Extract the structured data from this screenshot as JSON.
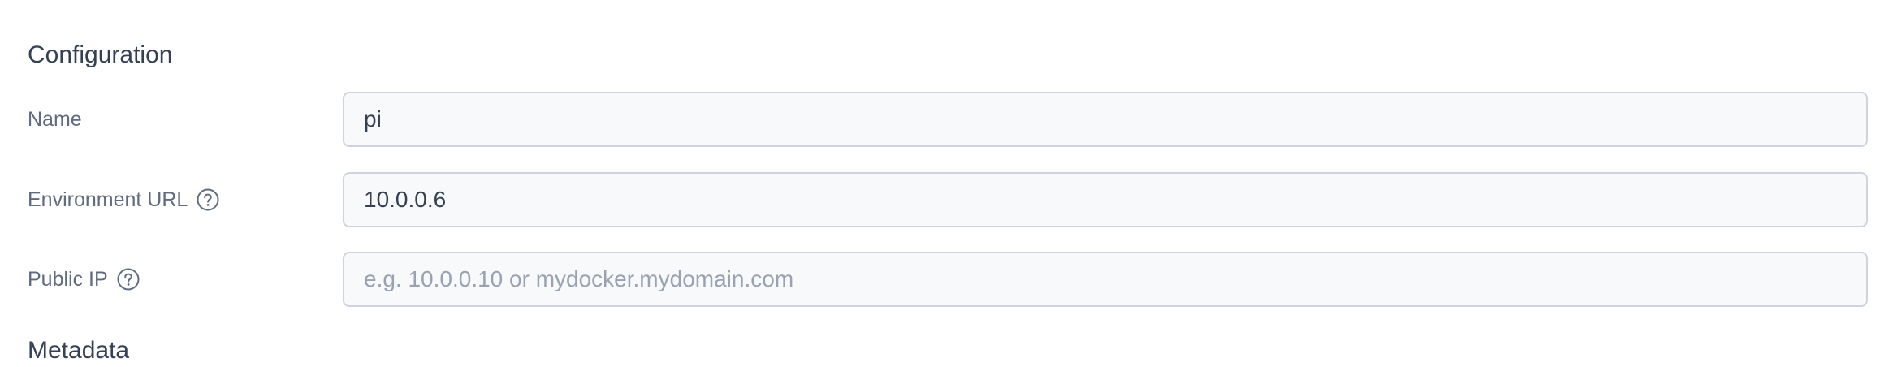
{
  "configuration": {
    "title": "Configuration",
    "name": {
      "label": "Name",
      "value": "pi"
    },
    "environment_url": {
      "label": "Environment URL",
      "value": "10.0.0.6",
      "help_icon": "question-circle-icon"
    },
    "public_ip": {
      "label": "Public IP",
      "value": "",
      "placeholder": "e.g. 10.0.0.10 or mydocker.mydomain.com",
      "help_icon": "question-circle-icon"
    }
  },
  "metadata": {
    "title": "Metadata"
  }
}
